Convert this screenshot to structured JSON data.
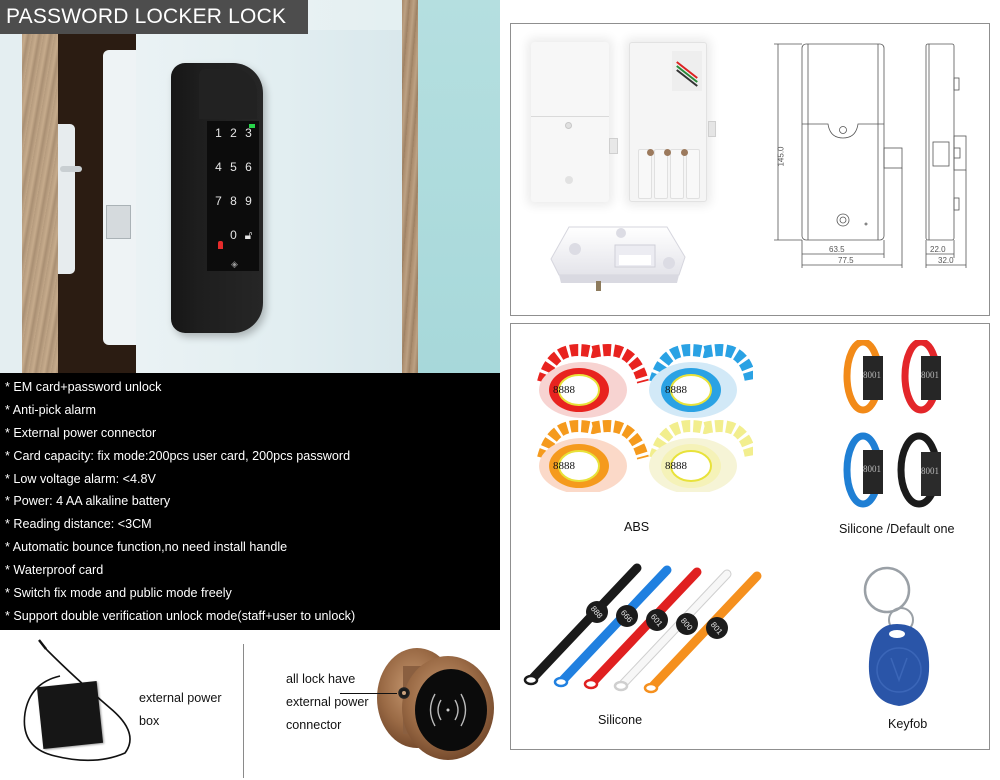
{
  "header": {
    "title": "PASSWORD LOCKER LOCK"
  },
  "hero": {
    "keypad_keys": [
      "1",
      "2",
      "3",
      "4",
      "5",
      "6",
      "7",
      "8",
      "9",
      "lock",
      "0",
      "unlock"
    ],
    "status_led_colors": {
      "ready": "#27d34a",
      "alarm": "#e52b2b"
    }
  },
  "features": {
    "items": [
      "* EM card+password unlock",
      "* Anti-pick alarm",
      "* External power connector",
      "* Card capacity: fix mode:200pcs user card, 200pcs password",
      "* Low voltage alarm: <4.8V",
      "* Power: 4 AA alkaline battery",
      "* Reading distance: <3CM",
      "* Automatic bounce function,no need install handle",
      "* Waterproof card",
      "* Switch fix mode and public mode freely",
      "* Support double verification unlock mode(staff+user to unlock)"
    ]
  },
  "accessories": {
    "power_box_label_line1": "external power",
    "power_box_label_line2": "box",
    "connector_label_line1": "all lock have",
    "connector_label_line2": "external power",
    "connector_label_line3": "connector"
  },
  "dimensions": {
    "height": "145.0",
    "body_width": "63.5",
    "total_width": "77.5",
    "body_depth": "22.0",
    "total_depth": "32.0"
  },
  "card_options": {
    "abs": {
      "caption": "ABS",
      "wristband_number": "8888",
      "colors": [
        "#e8231f",
        "#2aa2e4",
        "#f59a1d",
        "#f2ee8e"
      ]
    },
    "silicone_default": {
      "caption": "Silicone /Default one",
      "chip_number": "8001",
      "colors": [
        "#f28a18",
        "#e3262a",
        "#1f7fd4",
        "#1b1b1b"
      ]
    },
    "silicone": {
      "caption": "Silicone",
      "strap_numbers": [
        "888",
        "666",
        "601",
        "800",
        "801"
      ],
      "colors": [
        "#1a1a1a",
        "#2080e0",
        "#e02020",
        "#f2f2f2",
        "#f5901e"
      ]
    },
    "keyfob": {
      "caption": "Keyfob",
      "color": "#2a55a8"
    }
  }
}
